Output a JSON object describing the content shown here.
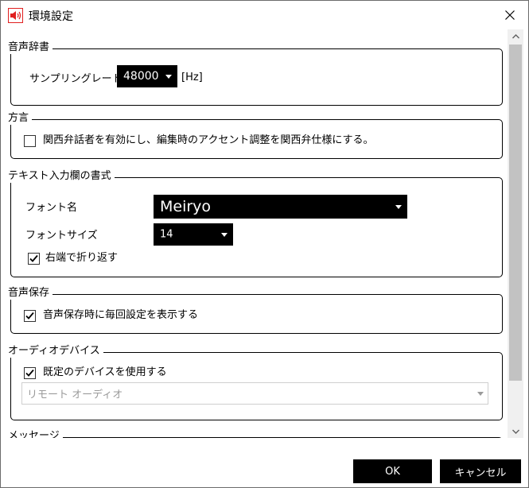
{
  "window": {
    "title": "環境設定"
  },
  "groups": {
    "dictionary": {
      "legend": "音声辞書",
      "sampling_label": "サンプリングレート",
      "sampling_value": "48000",
      "unit": "[Hz]"
    },
    "dialect": {
      "legend": "方言",
      "kansai_label": "関西弁話者を有効にし、編集時のアクセント調整を関西弁仕様にする。",
      "kansai_checked": false
    },
    "text_format": {
      "legend": "テキスト入力欄の書式",
      "font_name_label": "フォント名",
      "font_name_value": "Meiryo",
      "font_size_label": "フォントサイズ",
      "font_size_value": "14",
      "wrap_label": "右端で折り返す",
      "wrap_checked": true
    },
    "voice_save": {
      "legend": "音声保存",
      "show_settings_label": "音声保存時に毎回設定を表示する",
      "show_settings_checked": true
    },
    "audio_device": {
      "legend": "オーディオデバイス",
      "default_device_label": "既定のデバイスを使用する",
      "default_device_checked": true,
      "device_value": "リモート オーディオ"
    },
    "message": {
      "legend": "メッセージ"
    }
  },
  "buttons": {
    "ok": "OK",
    "cancel": "キャンセル"
  },
  "colors": {
    "accent": "#000000",
    "app_icon": "#e02020",
    "disabled_text": "#9a9a9a"
  }
}
